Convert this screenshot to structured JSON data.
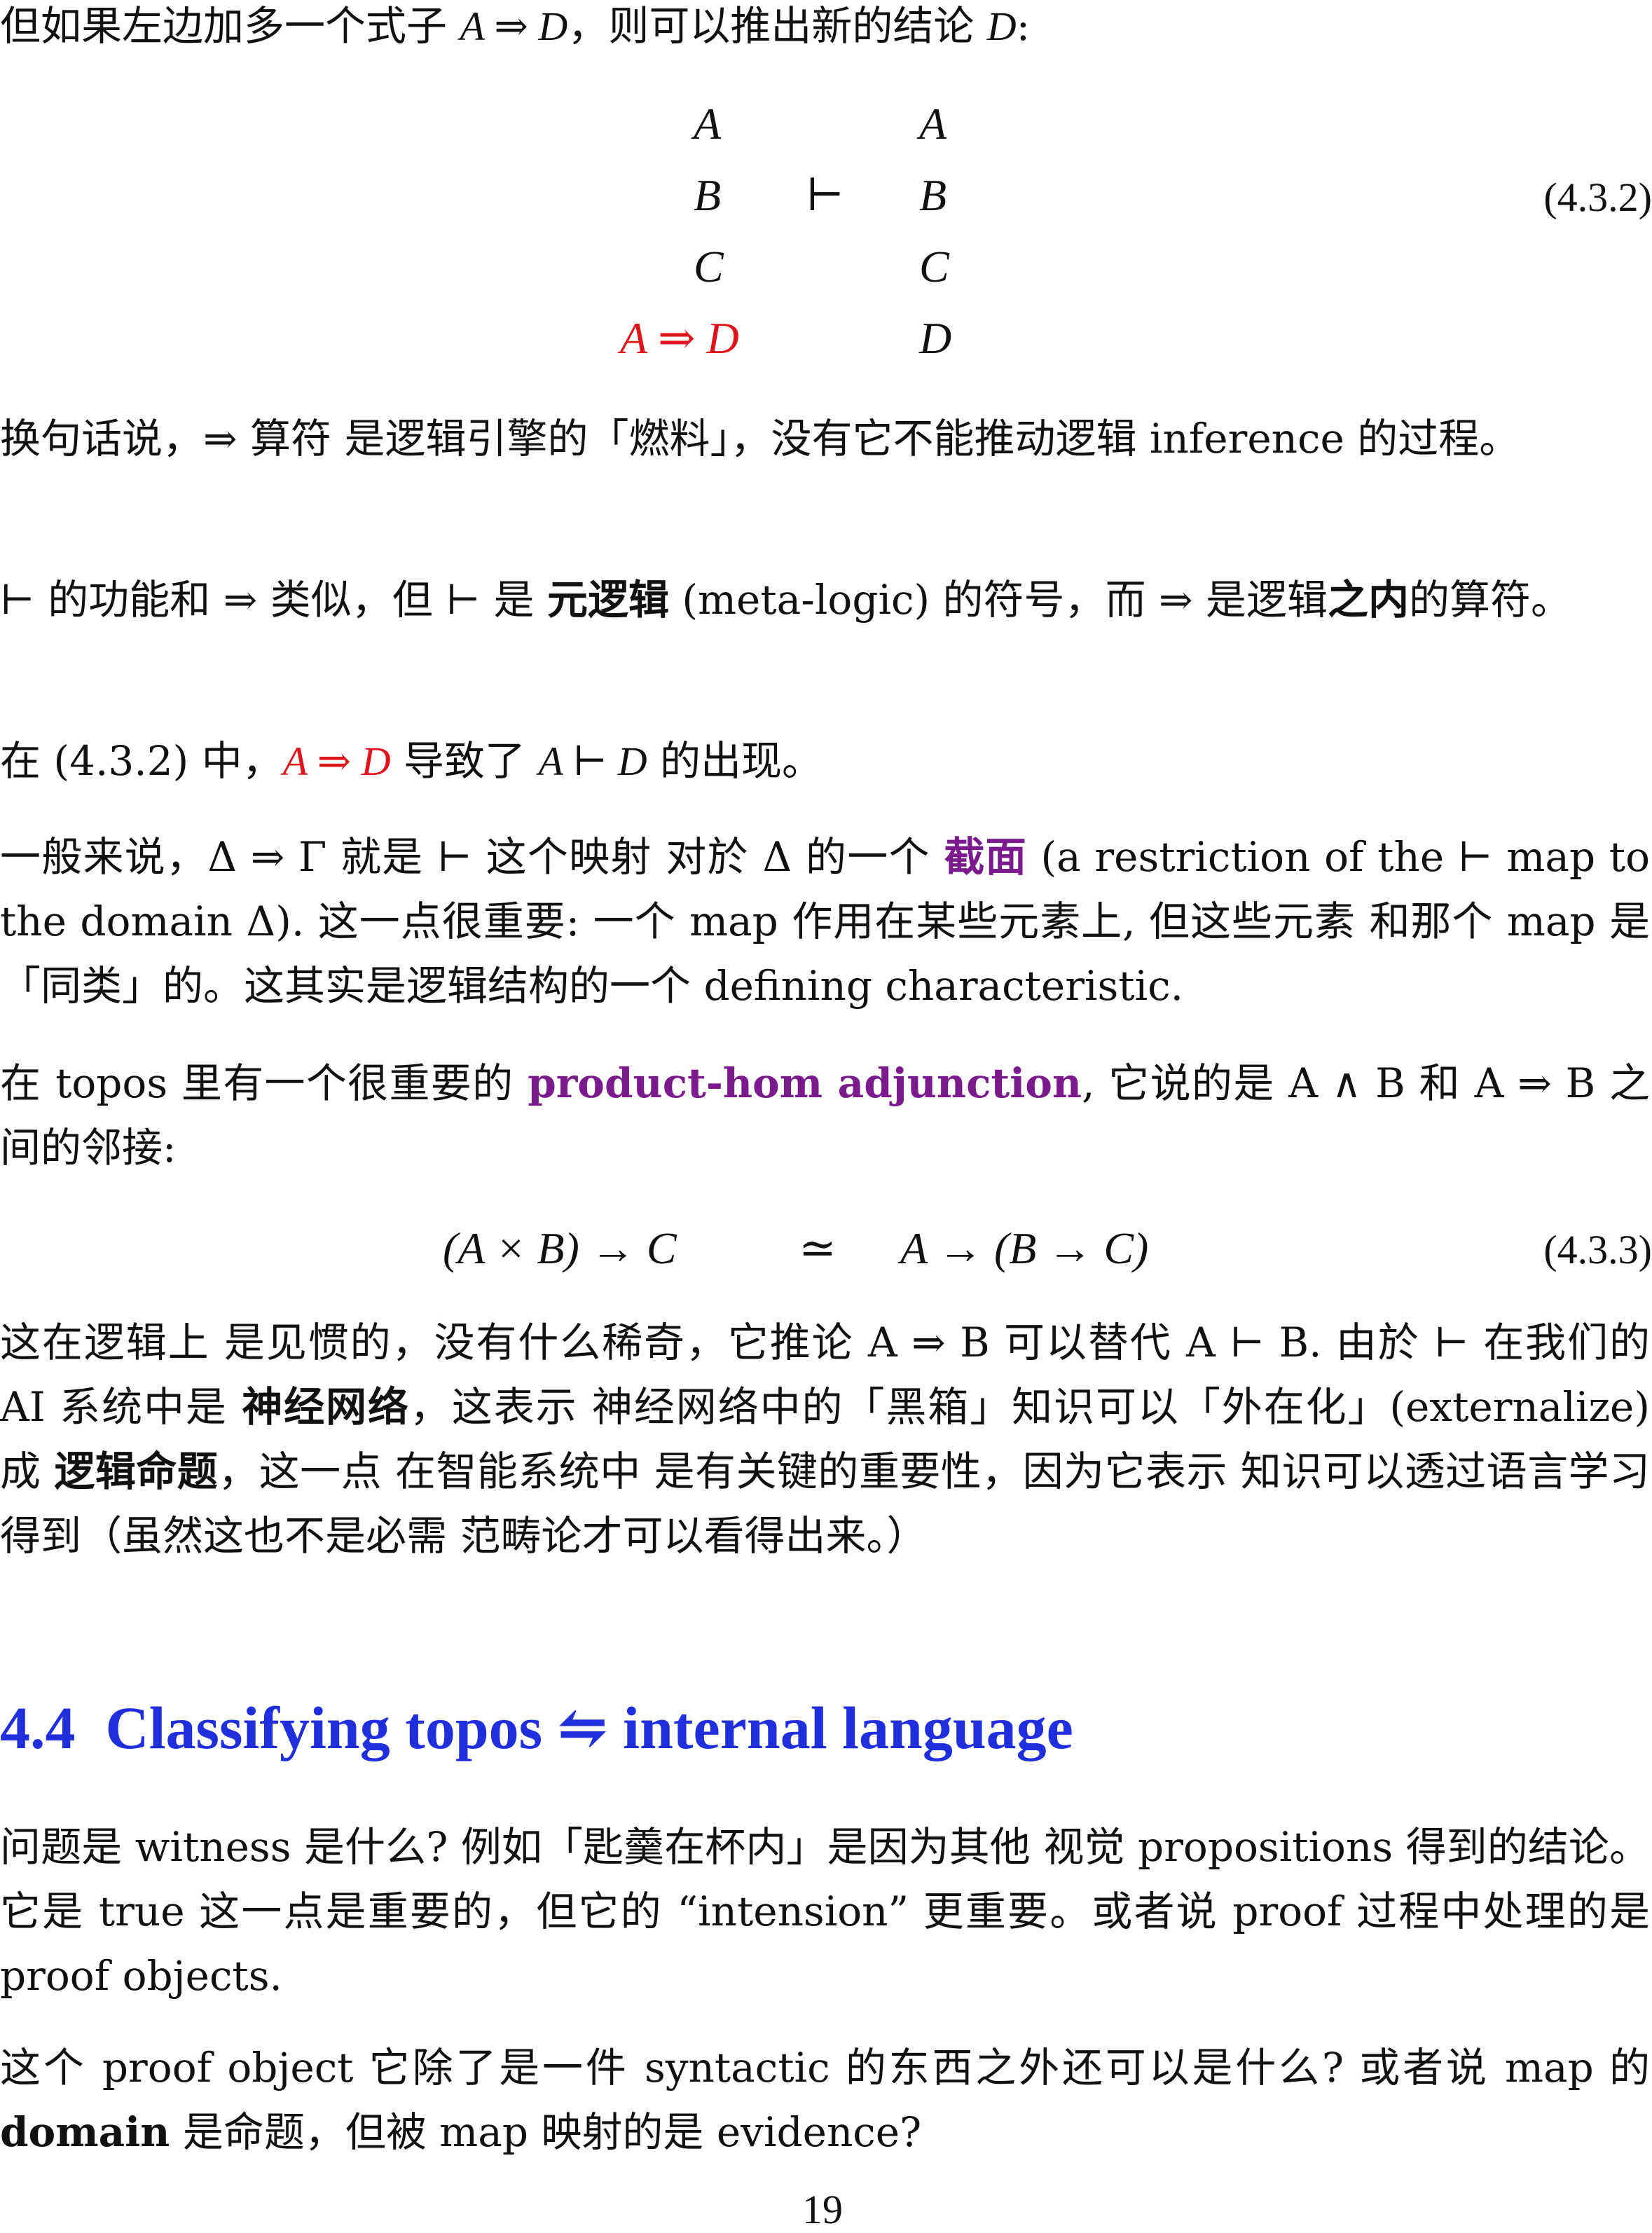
{
  "intro": {
    "text_before": "但如果左边加多一个式子 ",
    "formula": "A ⇒ D",
    "text_middle": "，则可以推出新的结论 ",
    "conclusion": "D",
    "text_end": ":"
  },
  "eq_432": {
    "left": [
      "A",
      "B",
      "C",
      "A ⇒ D"
    ],
    "turnstile": "⊢",
    "right": [
      "A",
      "B",
      "C",
      "D"
    ],
    "number": "(4.3.2)"
  },
  "para1": "换句话说，⇒ 算符 是逻辑引擎的「燃料」，没有它不能推动逻辑 inference 的过程。",
  "para2": {
    "part1": "⊢ 的功能和 ⇒ 类似，但 ⊢ 是 ",
    "bold1": "元逻辑",
    "part2": " (meta-logic) 的符号，而 ⇒ 是逻辑",
    "bold2": "之内",
    "part3": "的算符。"
  },
  "para3": {
    "part1": "在 (4.3.2) 中，",
    "red": "A ⇒ D",
    "part2": " 导致了 ",
    "math": "A ⊢ D",
    "part3": " 的出现。"
  },
  "para4": {
    "part1": "一般来说，Δ ⇒ Γ 就是 ⊢ 这个映射 对於 Δ 的一个 ",
    "highlight": "截面",
    "part2": " (a restriction of the ⊢ map to the domain Δ). 这一点很重要: 一个 map 作用在某些元素上, 但这些元素 和那个 map 是「同类」的。这其实是逻辑结构的一个 defining characteristic."
  },
  "para5": {
    "part1": "在 topos 里有一个很重要的 ",
    "highlight": "product-hom adjunction",
    "part2": ", 它说的是 A ∧ B 和 A ⇒ B 之间的邻接:"
  },
  "eq_433": {
    "lhs": "(A × B) → C",
    "rel": "≃",
    "rhs": "A → (B → C)",
    "number": "(4.3.3)"
  },
  "para6": {
    "part1": "这在逻辑上 是见惯的，没有什么稀奇，它推论 A ⇒ B 可以替代 A ⊢ B. 由於 ⊢ 在我们的 AI 系统中是 ",
    "bold1": "神经网络",
    "part2": "，这表示 神经网络中的「黑箱」知识可以「外在化」(externalize) 成 ",
    "bold2": "逻辑命题",
    "part3": "，这一点 在智能系统中 是有关键的重要性，因为它表示 知识可以透过语言学习得到（虽然这也不是必需 范畴论才可以看得出来。）"
  },
  "section": {
    "number": "4.4",
    "title": "Classifying topos ⇋ internal language"
  },
  "para7": "问题是 witness 是什么? 例如「匙羹在杯内」是因为其他 视觉 propositions 得到的结论。它是 true 这一点是重要的，但它的 “intension” 更重要。或者说 proof 过程中处理的是 proof objects.",
  "para8": {
    "part1": "这个 proof object 它除了是一件 syntactic 的东西之外还可以是什么? 或者说 map 的 ",
    "bold": "domain",
    "part2": " 是命题，但被 map 映射的是 evidence?"
  },
  "page_number": "19",
  "colors": {
    "red": "#e0141b",
    "purple": "#7a1a8c",
    "section_blue": "#1f2fdc"
  }
}
